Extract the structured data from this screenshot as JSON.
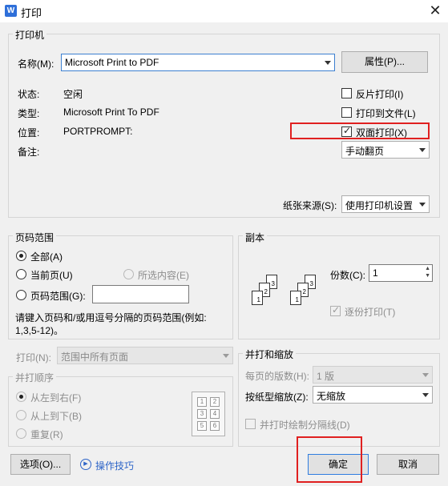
{
  "window": {
    "title": "打印",
    "app_icon_letter": "W"
  },
  "printer": {
    "group_label": "打印机",
    "name_label": "名称(M):",
    "name_value": "Microsoft Print to PDF",
    "properties_button": "属性(P)...",
    "status_label": "状态:",
    "status_value": "空闲",
    "type_label": "类型:",
    "type_value": "Microsoft Print To PDF",
    "location_label": "位置:",
    "location_value": "PORTPROMPT:",
    "comment_label": "备注:",
    "reverse_print": "反片打印(I)",
    "print_to_file": "打印到文件(L)",
    "duplex": "双面打印(X)",
    "duplex_mode": "手动翻页",
    "paper_source_label": "纸张来源(S):",
    "paper_source_value": "使用打印机设置"
  },
  "page_range": {
    "group_label": "页码范围",
    "all": "全部(A)",
    "current": "当前页(U)",
    "selection": "所选内容(E)",
    "range": "页码范围(G):",
    "hint_line1": "请键入页码和/或用逗号分隔的页码范围(例如:",
    "hint_line2": "1,3,5-12)。"
  },
  "copies": {
    "group_label": "副本",
    "count_label": "份数(C):",
    "count_value": "1",
    "collate": "逐份打印(T)"
  },
  "print_what": {
    "label": "打印(N):",
    "value": "范围中所有页面"
  },
  "order": {
    "group_label": "并打顺序",
    "left_to_right": "从左到右(F)",
    "top_to_bottom": "从上到下(B)",
    "repeat": "重复(R)",
    "grid": [
      "1",
      "2",
      "3",
      "4",
      "5",
      "6"
    ]
  },
  "zoom": {
    "group_label": "并打和缩放",
    "pages_per_sheet_label": "每页的版数(H):",
    "pages_per_sheet_value": "1 版",
    "scale_label": "按纸型缩放(Z):",
    "scale_value": "无缩放",
    "draw_lines": "并打时绘制分隔线(D)"
  },
  "footer": {
    "options_button": "选项(O)...",
    "tips_link": "操作技巧",
    "ok_button": "确定",
    "cancel_button": "取消"
  },
  "copies_illustration": [
    "1",
    "2",
    "3",
    "1",
    "2",
    "3"
  ]
}
